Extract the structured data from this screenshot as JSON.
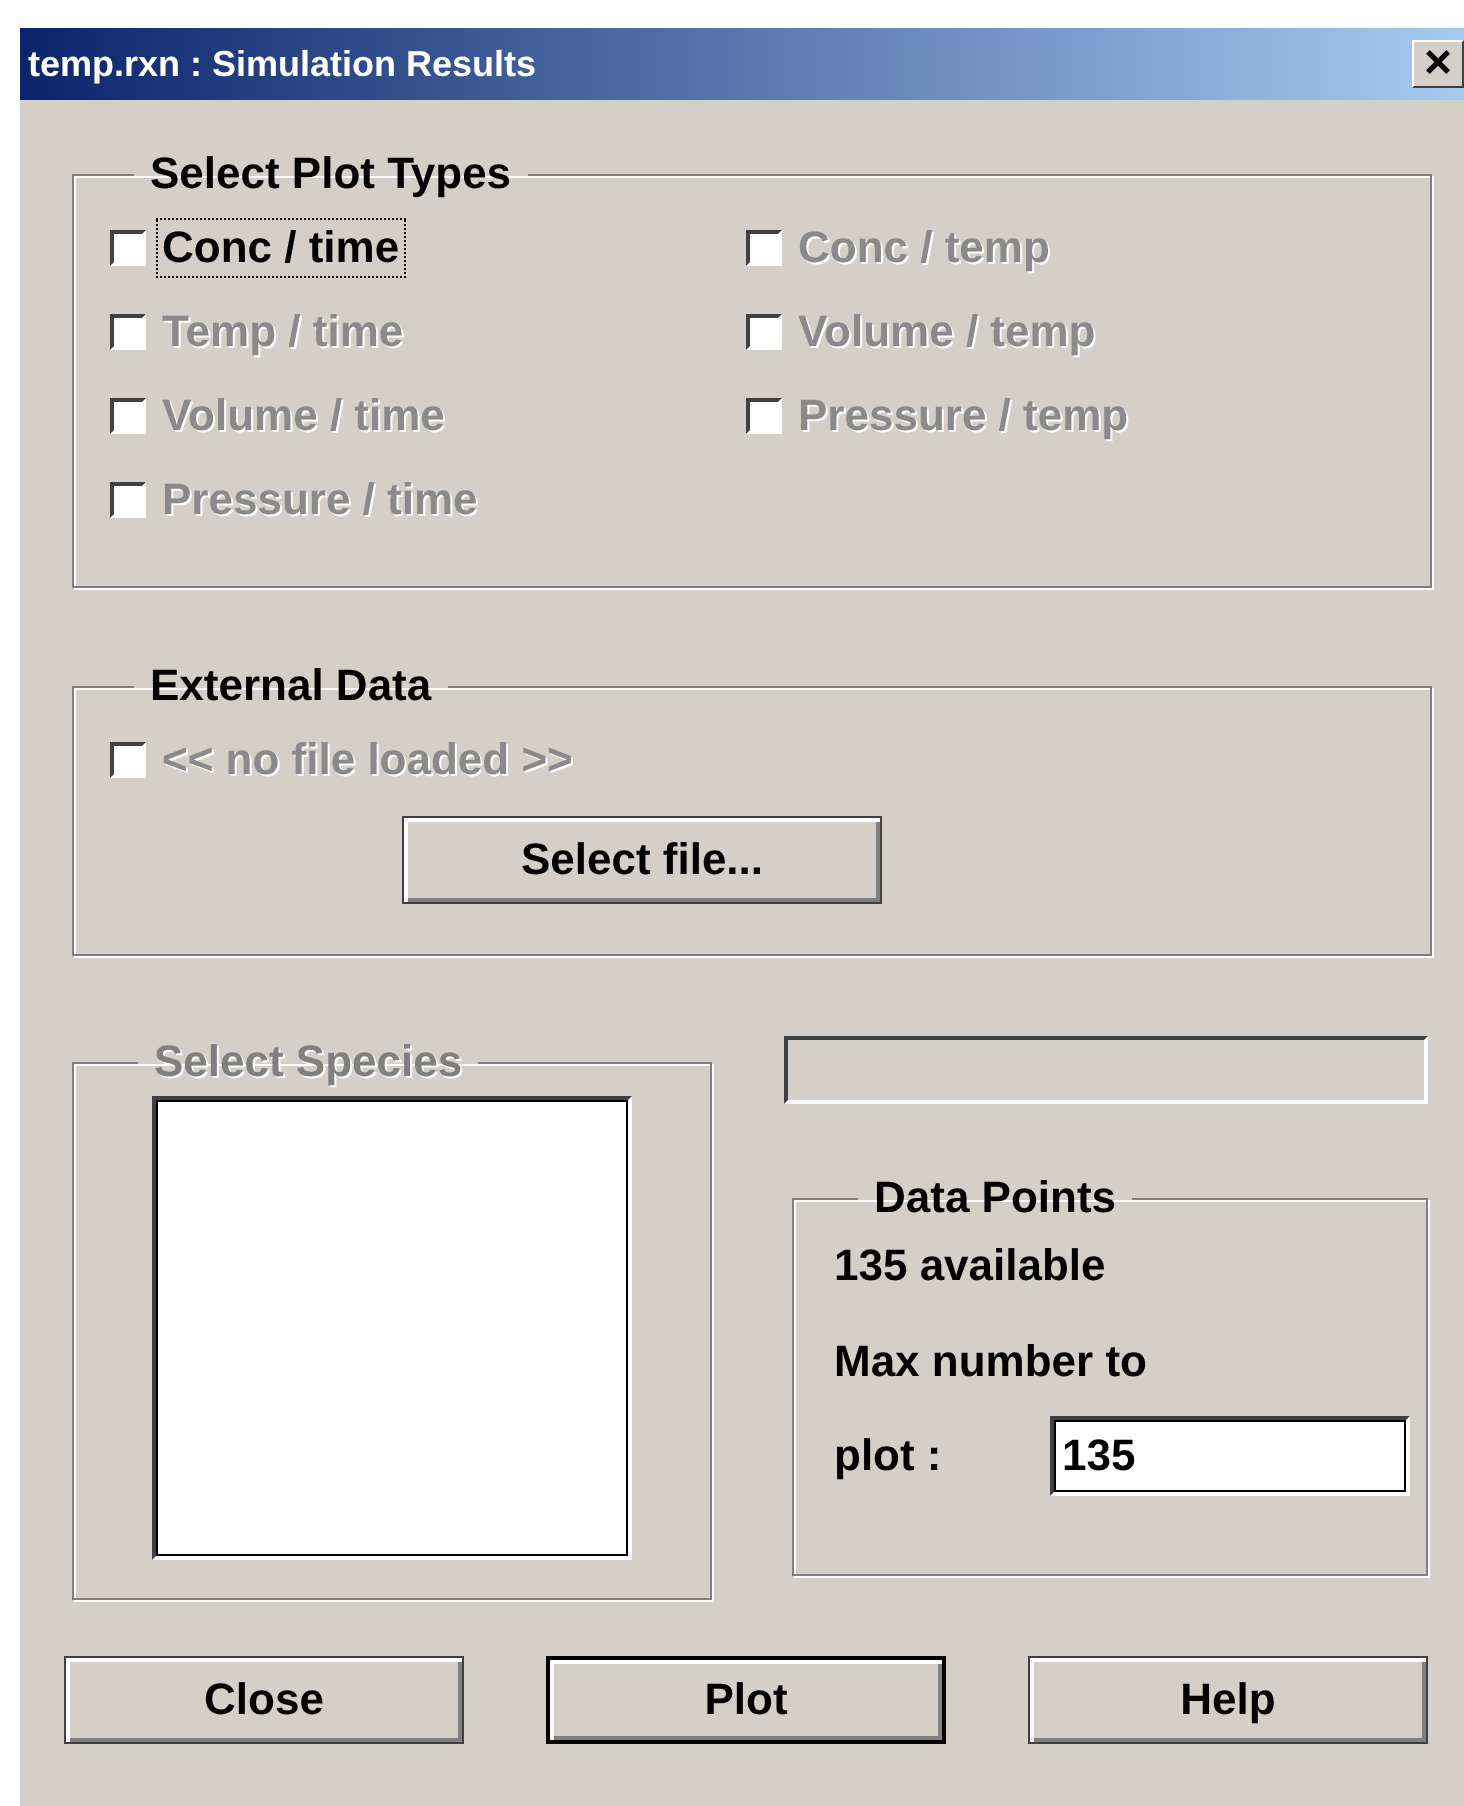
{
  "window": {
    "title": "temp.rxn : Simulation Results",
    "close_glyph": "×"
  },
  "plot_types": {
    "title": "Select Plot Types",
    "options": [
      {
        "label": "Conc / time",
        "checked": false,
        "disabled": false,
        "focused": true
      },
      {
        "label": "Conc / temp",
        "checked": false,
        "disabled": true,
        "focused": false
      },
      {
        "label": "Temp / time",
        "checked": false,
        "disabled": true,
        "focused": false
      },
      {
        "label": "Volume / temp",
        "checked": false,
        "disabled": true,
        "focused": false
      },
      {
        "label": "Volume / time",
        "checked": false,
        "disabled": true,
        "focused": false
      },
      {
        "label": "Pressure / temp",
        "checked": false,
        "disabled": true,
        "focused": false
      },
      {
        "label": "Pressure / time",
        "checked": false,
        "disabled": true,
        "focused": false
      }
    ]
  },
  "external_data": {
    "title": "External Data",
    "file": {
      "label": "<< no file loaded >>",
      "checked": false,
      "disabled": true
    },
    "button": "Select file..."
  },
  "species": {
    "title": "Select Species",
    "disabled": true
  },
  "progress": {
    "level": 0
  },
  "data_points": {
    "title": "Data Points",
    "available": "135 available",
    "max_label_1": "Max number to",
    "max_label_2": "plot :",
    "max_value": "135"
  },
  "buttons": [
    {
      "label": "Close",
      "default": false
    },
    {
      "label": "Plot",
      "default": true
    },
    {
      "label": "Help",
      "default": false
    }
  ]
}
